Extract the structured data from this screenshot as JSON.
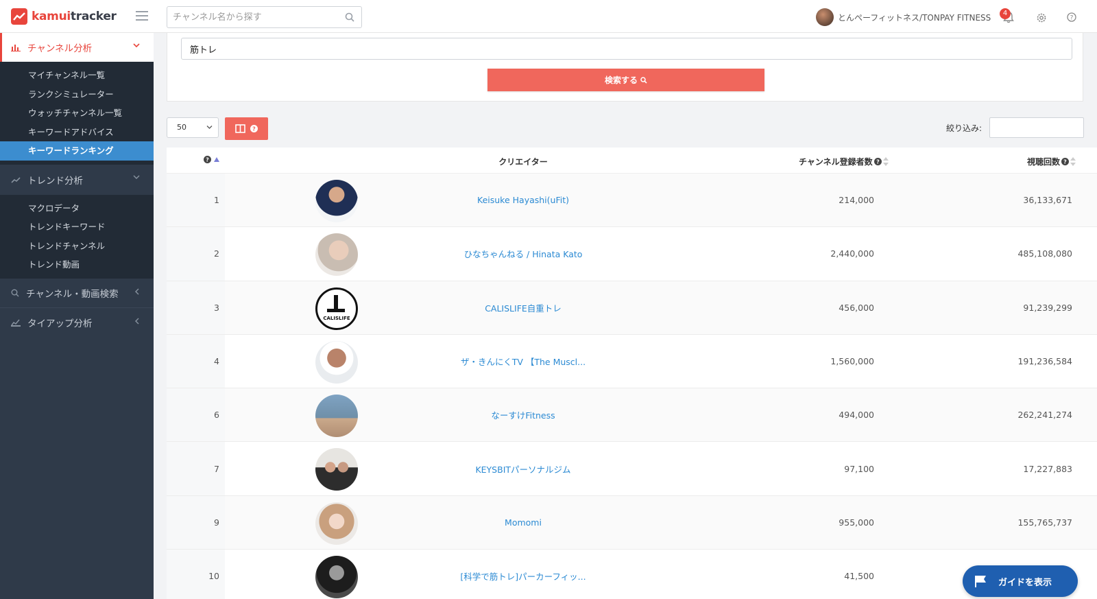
{
  "app": {
    "logo_prefix": "kamui",
    "logo_suffix": "tracker"
  },
  "header": {
    "search_placeholder": "チャンネル名から探す",
    "user_name": "とんぺーフィットネス/TONPAY FITNESS",
    "notification_count": "4"
  },
  "sidebar": {
    "sections": [
      {
        "label": "チャンネル分析",
        "icon": "bar-chart-icon",
        "expanded": true,
        "active": true
      },
      {
        "label": "トレンド分析",
        "icon": "trend-line-icon",
        "expanded": true,
        "active": false
      },
      {
        "label": "チャンネル・動画検索",
        "icon": "search-icon",
        "expanded": false,
        "active": false
      },
      {
        "label": "タイアップ分析",
        "icon": "tieup-icon",
        "expanded": false,
        "active": false
      }
    ],
    "channel_items": [
      "マイチャンネル一覧",
      "ランクシミュレーター",
      "ウォッチチャンネル一覧",
      "キーワードアドバイス",
      "キーワードランキング"
    ],
    "trend_items": [
      "マクロデータ",
      "トレンドキーワード",
      "トレンドチャンネル",
      "トレンド動画"
    ]
  },
  "search_panel": {
    "keyword_value": "筋トレ",
    "button_label": "検索する"
  },
  "controls": {
    "page_size": "50",
    "filter_label": "絞り込み:"
  },
  "table": {
    "headers": {
      "creator": "クリエイター",
      "subscribers": "チャンネル登録者数",
      "views": "視聴回数"
    },
    "rows": [
      {
        "rank": "1",
        "name": "Keisuke Hayashi(uFit)",
        "subscribers": "214,000",
        "views": "36,133,671"
      },
      {
        "rank": "2",
        "name": "ひなちゃんねる / Hinata Kato",
        "subscribers": "2,440,000",
        "views": "485,108,080"
      },
      {
        "rank": "3",
        "name": "CALISLIFE自重トレ",
        "subscribers": "456,000",
        "views": "91,239,299",
        "avatar_text": "CALISLIFE"
      },
      {
        "rank": "4",
        "name": "ザ・きんにくTV 【The Muscl...",
        "subscribers": "1,560,000",
        "views": "191,236,584"
      },
      {
        "rank": "6",
        "name": "なーすけFitness",
        "subscribers": "494,000",
        "views": "262,241,274"
      },
      {
        "rank": "7",
        "name": "KEYSBITパーソナルジム",
        "subscribers": "97,100",
        "views": "17,227,883"
      },
      {
        "rank": "9",
        "name": "Momomi",
        "subscribers": "955,000",
        "views": "155,765,737"
      },
      {
        "rank": "10",
        "name": "[科学で筋トレ]パーカーフィッ...",
        "subscribers": "41,500",
        "views": ""
      }
    ]
  },
  "guide": {
    "label": "ガイドを表示"
  },
  "colors": {
    "accent": "#e8453c",
    "button": "#f0675c",
    "link": "#2b8ad3",
    "sidebar_bg": "#2f3a49",
    "sidebar_active": "#3c8dcf",
    "guide_bg": "#1f5fb0"
  }
}
